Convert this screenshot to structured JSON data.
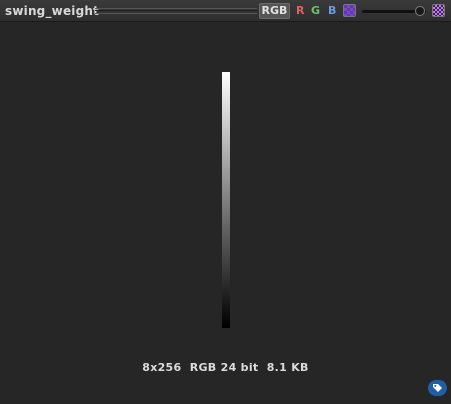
{
  "window": {
    "title": "swing_weight"
  },
  "toolbar": {
    "rgb_label": "RGB",
    "channel_r": "R",
    "channel_g": "G",
    "channel_b": "B",
    "channel_r_color": "#e06060",
    "channel_g_color": "#70c070",
    "channel_b_color": "#6a9ae0",
    "display_icon": "display-mode-icon",
    "checker_icon": "checkerboard-icon",
    "zoom_fraction": 0.9
  },
  "image": {
    "content": "vertical gradient white to black"
  },
  "info": {
    "text": "8x256  RGB 24 bit  8.1 KB"
  },
  "corner": {
    "icon": "tag-icon",
    "color": "#1f5fa8"
  }
}
